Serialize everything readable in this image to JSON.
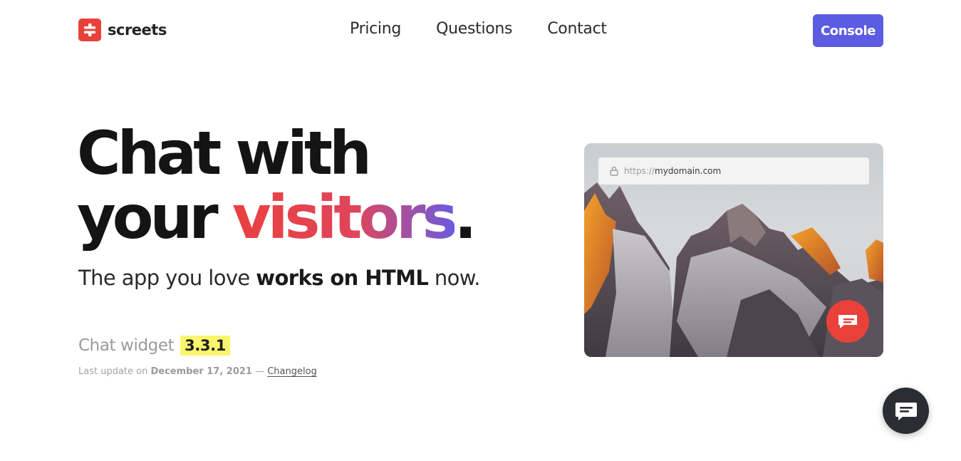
{
  "brand": {
    "name": "screets",
    "logo_icon": "screets-logo-icon",
    "accent": "#e8413a"
  },
  "nav": {
    "items": [
      {
        "label": "Pricing"
      },
      {
        "label": "Questions"
      },
      {
        "label": "Contact"
      }
    ]
  },
  "header": {
    "console_label": "Console",
    "console_color": "#5b5ce2"
  },
  "hero": {
    "line1": "Chat with",
    "line2_plain": "your ",
    "line2_highlight": "visitors",
    "line2_end": ".",
    "tagline_start": "The app you love ",
    "tagline_bold": "works on HTML",
    "tagline_end": " now."
  },
  "widget": {
    "label": "Chat widget ",
    "version": "3.3.1",
    "update_prefix": "Last update on ",
    "update_date": "December 17, 2021",
    "update_sep": " — ",
    "changelog_label": "Changelog"
  },
  "preview": {
    "url_protocol": "https://",
    "url_domain": "mydomain.com",
    "lock_icon": "lock-icon",
    "chat_icon": "chat-bubble-icon"
  },
  "floating_chat": {
    "icon": "chat-bubble-icon",
    "color": "#2a2d33"
  }
}
